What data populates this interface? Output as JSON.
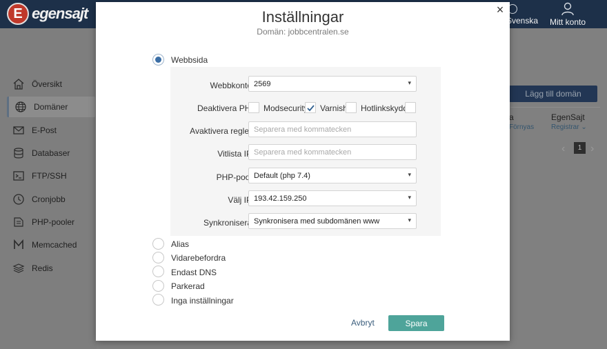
{
  "header": {
    "logo_letter": "E",
    "logo_text": "egensajt",
    "language_label": "Svenska",
    "account_label": "Mitt konto"
  },
  "sidebar": {
    "items": [
      {
        "label": "Översikt",
        "icon": "house-icon"
      },
      {
        "label": "Domäner",
        "icon": "globe-icon",
        "active": true
      },
      {
        "label": "E-Post",
        "icon": "envelope-icon"
      },
      {
        "label": "Databaser",
        "icon": "database-icon"
      },
      {
        "label": "FTP/SSH",
        "icon": "terminal-icon"
      },
      {
        "label": "Cronjobb",
        "icon": "clock-icon"
      },
      {
        "label": "PHP-pooler",
        "icon": "php-icon"
      },
      {
        "label": "Memcached",
        "icon": "memcached-icon"
      },
      {
        "label": "Redis",
        "icon": "redis-icon"
      }
    ]
  },
  "background": {
    "add_domain_button": "Lägg till domän",
    "column_a": "a",
    "column_a_sub": "Förnyas",
    "column_egensajt": "EgenSajt",
    "column_egensajt_sub": "Registrar",
    "page_number": "1"
  },
  "modal": {
    "title": "Inställningar",
    "subtitle": "Domän: jobbcentralen.se",
    "close_label": "×",
    "options": [
      {
        "label": "Webbsida",
        "checked": true
      },
      {
        "label": "Alias",
        "checked": false
      },
      {
        "label": "Vidarebefordra",
        "checked": false
      },
      {
        "label": "Endast DNS",
        "checked": false
      },
      {
        "label": "Parkerad",
        "checked": false
      },
      {
        "label": "Inga inställningar",
        "checked": false
      }
    ],
    "form": {
      "webbkonto_label": "Webbkonto",
      "webbkonto_value": "2569",
      "deactivate_php_label": "Deaktivera PHP",
      "deactivate_php_checked": false,
      "modsecurity_label": "Modsecurity",
      "modsecurity_checked": true,
      "varnish_label": "Varnish",
      "varnish_checked": false,
      "hotlinkskydd_label": "Hotlinkskydd",
      "hotlinkskydd_checked": false,
      "deactivate_rules_label": "Avaktivera regler",
      "deactivate_rules_placeholder": "Separera med kommatecken",
      "whitelist_ip_label": "Vitlista IP",
      "whitelist_ip_placeholder": "Separera med kommatecken",
      "php_pool_label": "PHP-pool",
      "php_pool_value": "Default (php 7.4)",
      "choose_ip_label": "Välj IP",
      "choose_ip_value": "193.42.159.250",
      "sync_label": "Synkronisera",
      "sync_value": "Synkronisera med subdomänen www"
    },
    "cancel_label": "Avbryt",
    "save_label": "Spara"
  },
  "colors": {
    "header_bg": "#1d3049",
    "save_button": "#4ea49a",
    "radio_selected": "#3b6ea5",
    "overlay": "#808080"
  }
}
